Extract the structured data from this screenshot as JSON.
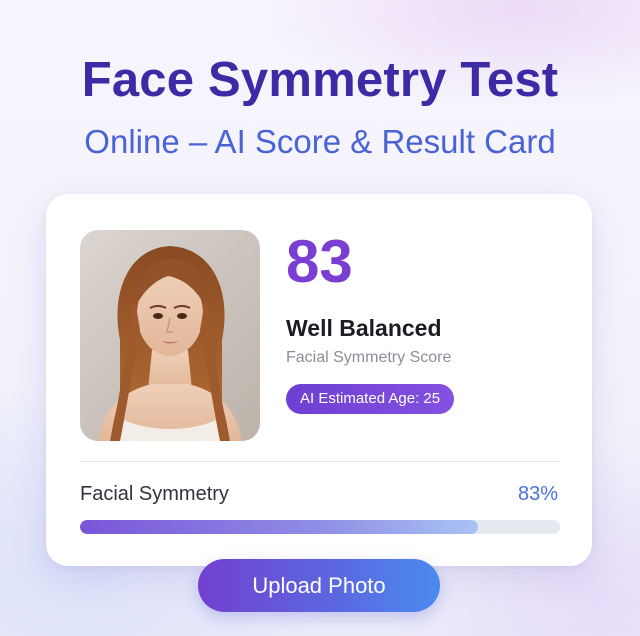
{
  "header": {
    "title": "Face Symmetry Test",
    "subtitle": "Online – AI Score & Result Card"
  },
  "result_card": {
    "score": "83",
    "status": "Well Balanced",
    "caption": "Facial Symmetry Score",
    "age_badge": "AI Estimated Age: 25",
    "metric": {
      "label": "Facial Symmetry",
      "value_text": "83%",
      "progress": 0.83
    }
  },
  "upload_button": {
    "label": "Upload Photo"
  },
  "colors": {
    "title": "#3d2aa5",
    "subtitle": "#4a64d6",
    "score": "#7a3fd2",
    "badge": "#6e3fd3",
    "metric_value": "#4a6fe0",
    "button_start": "#7240cf",
    "button_end": "#4a8bf0"
  }
}
